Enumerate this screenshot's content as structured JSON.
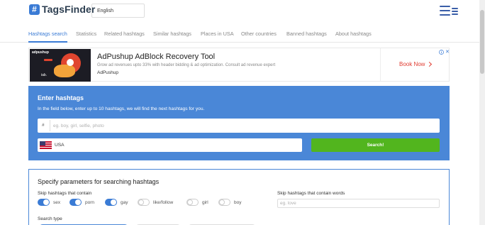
{
  "header": {
    "logo_mark": "#",
    "logo_text": "TagsFinder",
    "language": "English"
  },
  "nav": {
    "items": [
      {
        "label": "Hashtags search",
        "active": true
      },
      {
        "label": "Statistics"
      },
      {
        "label": "Related hashtags"
      },
      {
        "label": "Similar hashtags"
      },
      {
        "label": "Places in USA"
      },
      {
        "label": "Other countries"
      },
      {
        "label": "Banned hashtags"
      },
      {
        "label": "About hashtags"
      }
    ]
  },
  "ad": {
    "image_brand": "adpushup",
    "image_footer": "iab.",
    "title": "AdPushup AdBlock Recovery Tool",
    "description": "Grow ad revenues upto 33% with header bidding & ad optimization. Consult ad revenue expert",
    "source": "AdPushup",
    "cta": "Book Now",
    "info_icon": "info-icon",
    "close_symbol": "✕"
  },
  "search_panel": {
    "title": "Enter hashtags",
    "description": "In the field below, enter up to 10 hashtags, we will find the next hashtags for you.",
    "hash_symbol": "#",
    "input_placeholder": "eg. boy, girl, selfie, photo",
    "input_value": "",
    "country": "USA",
    "search_button": "Search!"
  },
  "params": {
    "title": "Specify parameters for searching hashtags",
    "skip_label": "Skip hashtags that contain",
    "toggles": [
      {
        "label": "sex",
        "on": true
      },
      {
        "label": "porn",
        "on": true
      },
      {
        "label": "gay",
        "on": true
      },
      {
        "label": "like/follow",
        "on": false
      },
      {
        "label": "girl",
        "on": false
      },
      {
        "label": "boy",
        "on": false
      }
    ],
    "skip_words_label": "Skip hashtags that contain words",
    "skip_words_placeholder": "eg. love",
    "search_type_label": "Search type"
  },
  "colors": {
    "primary_blue": "#4a87d7",
    "link_blue": "#3a7bd5",
    "search_green": "#52b51e",
    "cta_red": "#e03c31"
  }
}
